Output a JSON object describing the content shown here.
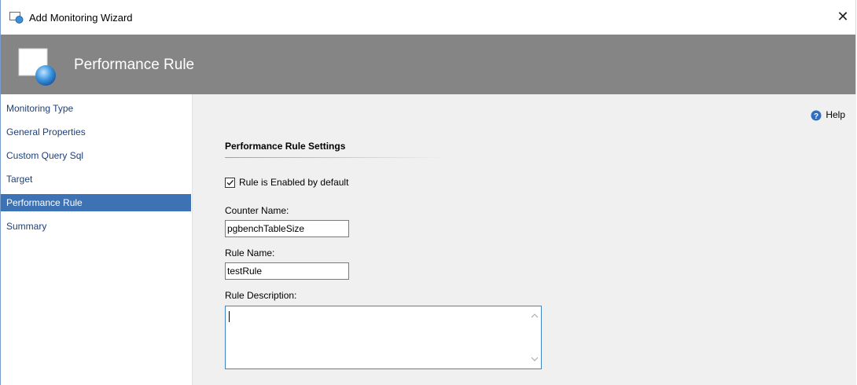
{
  "window": {
    "title": "Add Monitoring Wizard",
    "close_label": "✕"
  },
  "banner": {
    "title": "Performance Rule"
  },
  "sidebar": {
    "items": [
      {
        "label": "Monitoring Type",
        "active": false
      },
      {
        "label": "General Properties",
        "active": false
      },
      {
        "label": "Custom Query Sql",
        "active": false
      },
      {
        "label": "Target",
        "active": false
      },
      {
        "label": "Performance Rule",
        "active": true
      },
      {
        "label": "Summary",
        "active": false
      }
    ]
  },
  "content": {
    "help_label": "Help",
    "section_title": "Performance Rule Settings",
    "enabled_checkbox": {
      "label": "Rule is Enabled by default",
      "checked": true
    },
    "counter_name": {
      "label": "Counter Name:",
      "value": "pgbenchTableSize"
    },
    "rule_name": {
      "label": "Rule Name:",
      "value": "testRule"
    },
    "rule_description": {
      "label": "Rule Description:",
      "value": ""
    }
  },
  "colors": {
    "banner_bg": "#858585",
    "active_nav_bg": "#3d72b4",
    "content_bg": "#f0f0f0",
    "nav_text": "#1e3f7a"
  }
}
